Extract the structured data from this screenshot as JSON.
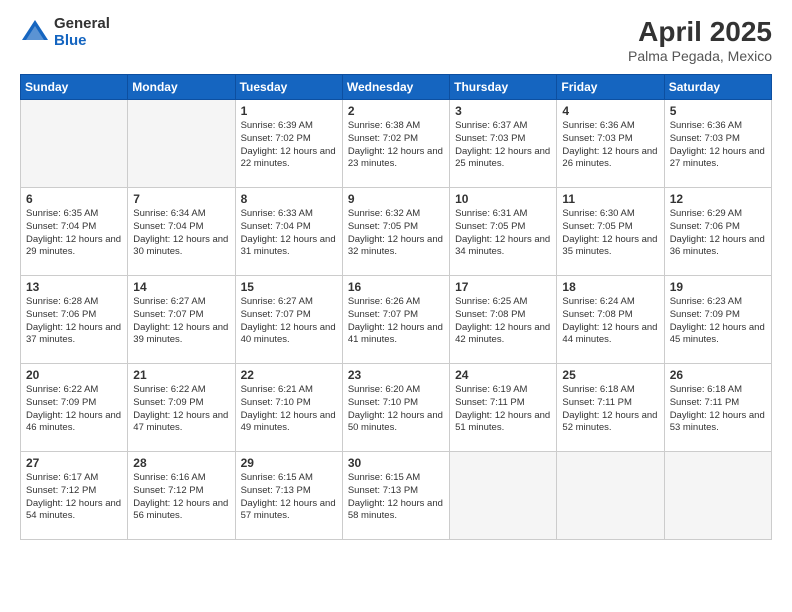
{
  "header": {
    "logo_general": "General",
    "logo_blue": "Blue",
    "main_title": "April 2025",
    "subtitle": "Palma Pegada, Mexico"
  },
  "days_of_week": [
    "Sunday",
    "Monday",
    "Tuesday",
    "Wednesday",
    "Thursday",
    "Friday",
    "Saturday"
  ],
  "weeks": [
    [
      {
        "day": "",
        "info": ""
      },
      {
        "day": "",
        "info": ""
      },
      {
        "day": "1",
        "info": "Sunrise: 6:39 AM\nSunset: 7:02 PM\nDaylight: 12 hours and 22 minutes."
      },
      {
        "day": "2",
        "info": "Sunrise: 6:38 AM\nSunset: 7:02 PM\nDaylight: 12 hours and 23 minutes."
      },
      {
        "day": "3",
        "info": "Sunrise: 6:37 AM\nSunset: 7:03 PM\nDaylight: 12 hours and 25 minutes."
      },
      {
        "day": "4",
        "info": "Sunrise: 6:36 AM\nSunset: 7:03 PM\nDaylight: 12 hours and 26 minutes."
      },
      {
        "day": "5",
        "info": "Sunrise: 6:36 AM\nSunset: 7:03 PM\nDaylight: 12 hours and 27 minutes."
      }
    ],
    [
      {
        "day": "6",
        "info": "Sunrise: 6:35 AM\nSunset: 7:04 PM\nDaylight: 12 hours and 29 minutes."
      },
      {
        "day": "7",
        "info": "Sunrise: 6:34 AM\nSunset: 7:04 PM\nDaylight: 12 hours and 30 minutes."
      },
      {
        "day": "8",
        "info": "Sunrise: 6:33 AM\nSunset: 7:04 PM\nDaylight: 12 hours and 31 minutes."
      },
      {
        "day": "9",
        "info": "Sunrise: 6:32 AM\nSunset: 7:05 PM\nDaylight: 12 hours and 32 minutes."
      },
      {
        "day": "10",
        "info": "Sunrise: 6:31 AM\nSunset: 7:05 PM\nDaylight: 12 hours and 34 minutes."
      },
      {
        "day": "11",
        "info": "Sunrise: 6:30 AM\nSunset: 7:05 PM\nDaylight: 12 hours and 35 minutes."
      },
      {
        "day": "12",
        "info": "Sunrise: 6:29 AM\nSunset: 7:06 PM\nDaylight: 12 hours and 36 minutes."
      }
    ],
    [
      {
        "day": "13",
        "info": "Sunrise: 6:28 AM\nSunset: 7:06 PM\nDaylight: 12 hours and 37 minutes."
      },
      {
        "day": "14",
        "info": "Sunrise: 6:27 AM\nSunset: 7:07 PM\nDaylight: 12 hours and 39 minutes."
      },
      {
        "day": "15",
        "info": "Sunrise: 6:27 AM\nSunset: 7:07 PM\nDaylight: 12 hours and 40 minutes."
      },
      {
        "day": "16",
        "info": "Sunrise: 6:26 AM\nSunset: 7:07 PM\nDaylight: 12 hours and 41 minutes."
      },
      {
        "day": "17",
        "info": "Sunrise: 6:25 AM\nSunset: 7:08 PM\nDaylight: 12 hours and 42 minutes."
      },
      {
        "day": "18",
        "info": "Sunrise: 6:24 AM\nSunset: 7:08 PM\nDaylight: 12 hours and 44 minutes."
      },
      {
        "day": "19",
        "info": "Sunrise: 6:23 AM\nSunset: 7:09 PM\nDaylight: 12 hours and 45 minutes."
      }
    ],
    [
      {
        "day": "20",
        "info": "Sunrise: 6:22 AM\nSunset: 7:09 PM\nDaylight: 12 hours and 46 minutes."
      },
      {
        "day": "21",
        "info": "Sunrise: 6:22 AM\nSunset: 7:09 PM\nDaylight: 12 hours and 47 minutes."
      },
      {
        "day": "22",
        "info": "Sunrise: 6:21 AM\nSunset: 7:10 PM\nDaylight: 12 hours and 49 minutes."
      },
      {
        "day": "23",
        "info": "Sunrise: 6:20 AM\nSunset: 7:10 PM\nDaylight: 12 hours and 50 minutes."
      },
      {
        "day": "24",
        "info": "Sunrise: 6:19 AM\nSunset: 7:11 PM\nDaylight: 12 hours and 51 minutes."
      },
      {
        "day": "25",
        "info": "Sunrise: 6:18 AM\nSunset: 7:11 PM\nDaylight: 12 hours and 52 minutes."
      },
      {
        "day": "26",
        "info": "Sunrise: 6:18 AM\nSunset: 7:11 PM\nDaylight: 12 hours and 53 minutes."
      }
    ],
    [
      {
        "day": "27",
        "info": "Sunrise: 6:17 AM\nSunset: 7:12 PM\nDaylight: 12 hours and 54 minutes."
      },
      {
        "day": "28",
        "info": "Sunrise: 6:16 AM\nSunset: 7:12 PM\nDaylight: 12 hours and 56 minutes."
      },
      {
        "day": "29",
        "info": "Sunrise: 6:15 AM\nSunset: 7:13 PM\nDaylight: 12 hours and 57 minutes."
      },
      {
        "day": "30",
        "info": "Sunrise: 6:15 AM\nSunset: 7:13 PM\nDaylight: 12 hours and 58 minutes."
      },
      {
        "day": "",
        "info": ""
      },
      {
        "day": "",
        "info": ""
      },
      {
        "day": "",
        "info": ""
      }
    ]
  ]
}
